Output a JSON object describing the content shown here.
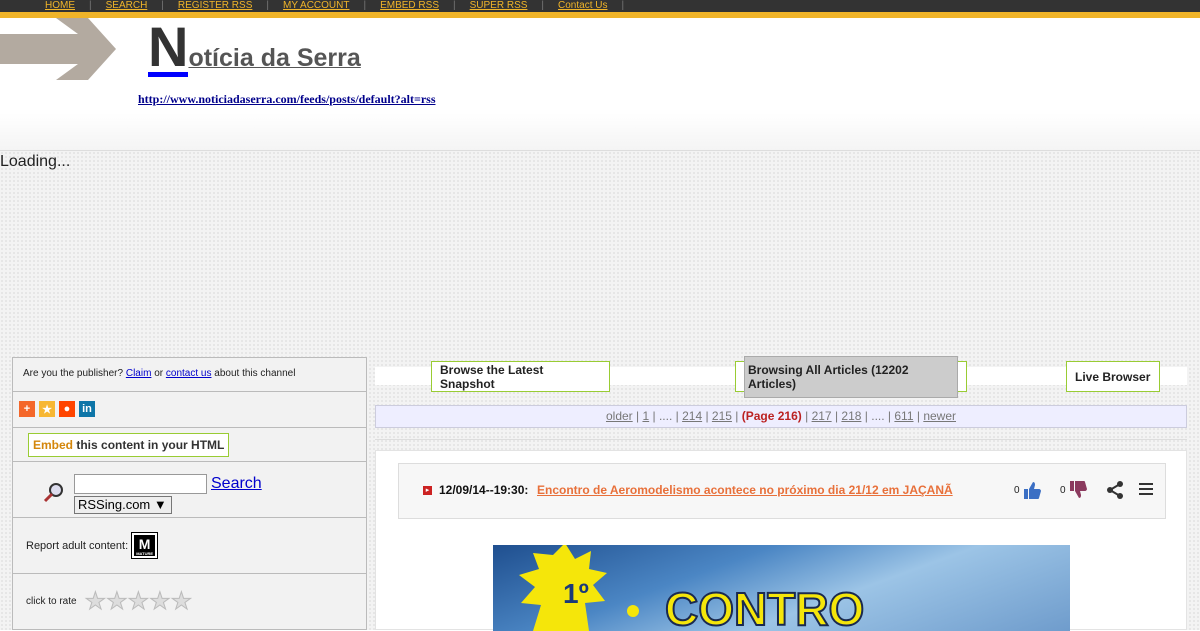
{
  "topnav": {
    "items": [
      "HOME",
      "SEARCH",
      "REGISTER RSS",
      "MY ACCOUNT",
      "EMBED RSS",
      "SUPER RSS",
      "Contact Us"
    ]
  },
  "header": {
    "title_initial": "N",
    "title_rest": "otícia da Serra",
    "feed_url": "http://www.noticiadaserra.com/feeds/posts/default?alt=rss"
  },
  "loading_text": "Loading...",
  "leftpanel": {
    "publisher_prefix": "Are you the publisher?",
    "claim": "Claim",
    "or": "or",
    "contact": "contact us",
    "publisher_suffix": "about this channel",
    "embed_word": "Embed",
    "embed_rest": "this content in your HTML",
    "search_link": "Search",
    "search_select": "RSSing.com",
    "adult_label": "Report adult content:",
    "mature_letter": "M",
    "mature_sub": "MATURE",
    "rate_label": "click to rate"
  },
  "browse": {
    "latest": "Browse the Latest Snapshot",
    "all": "Browsing All Articles (12202 Articles)",
    "live": "Live Browser"
  },
  "pager": {
    "older": "older",
    "p1": "1",
    "dots": "....",
    "p214": "214",
    "p215": "215",
    "current": "(Page 216)",
    "p217": "217",
    "p218": "218",
    "p611": "611",
    "newer": "newer"
  },
  "article": {
    "date": "12/09/14--19:30:",
    "title": "Encontro de Aeromodelismo acontece no próximo dia 21/12 em JAÇANÃ",
    "likes": "0",
    "dislikes": "0",
    "image_text": "CONTRO",
    "image_number": "1º"
  },
  "colors": {
    "accent": "#f0b429",
    "link_orange": "#e8703a",
    "border_green": "#99cc33"
  }
}
